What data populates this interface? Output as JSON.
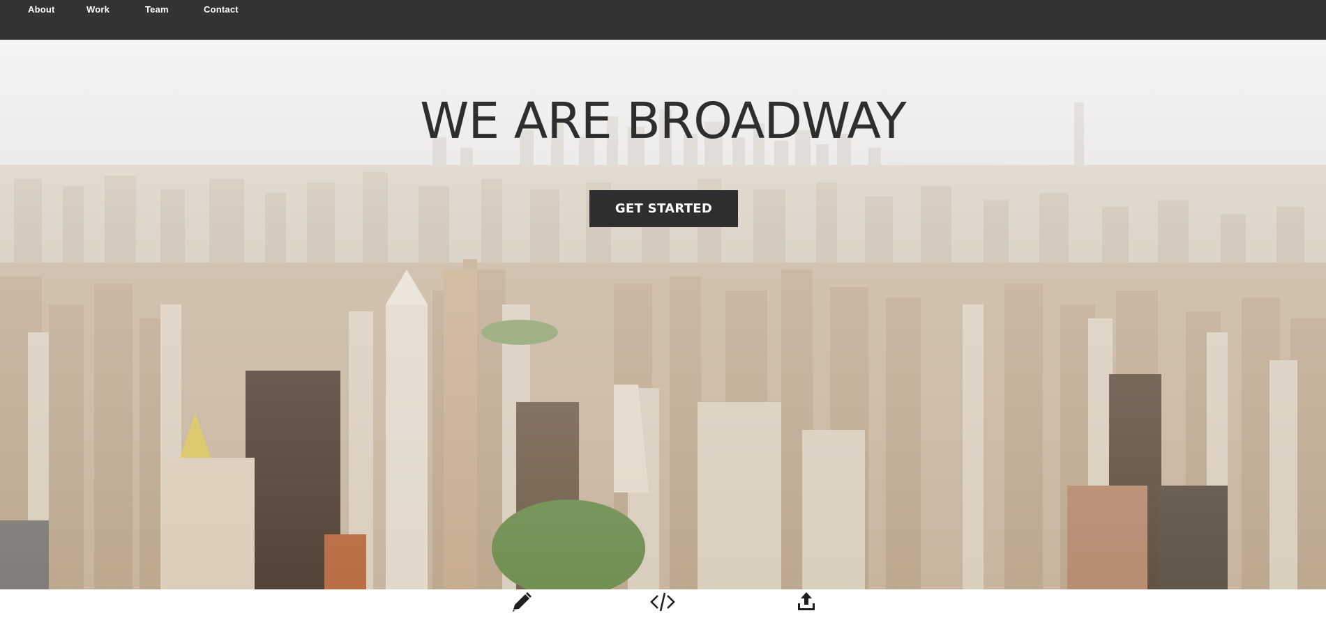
{
  "nav": {
    "items": [
      {
        "label": "About"
      },
      {
        "label": "Work"
      },
      {
        "label": "Team"
      },
      {
        "label": "Contact"
      }
    ]
  },
  "hero": {
    "title": "WE ARE BROADWAY",
    "cta_label": "GET STARTED",
    "background": "aerial-city-skyline-photo"
  },
  "features": {
    "icons": [
      "pencil-icon",
      "code-icon",
      "upload-icon"
    ]
  },
  "colors": {
    "navbar": "#333333",
    "text_dark": "#2e2e2e",
    "button": "#2e2e2e",
    "button_text": "#ffffff"
  }
}
